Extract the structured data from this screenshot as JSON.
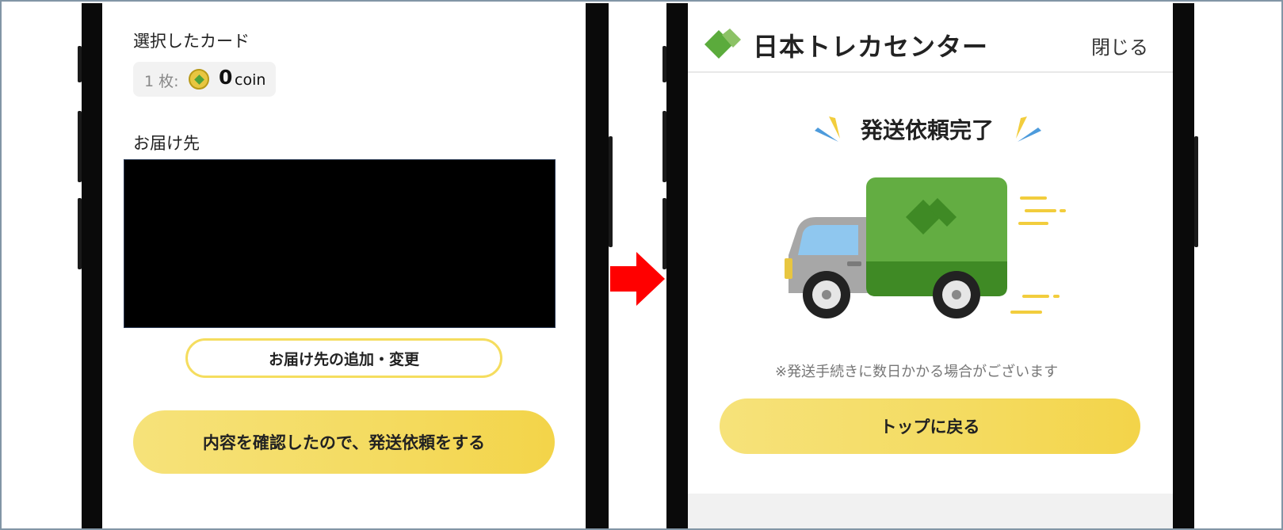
{
  "left_screen": {
    "selected_cards_label": "選択したカード",
    "card_count": "1 枚:",
    "coin_value": "0",
    "coin_unit": "coin",
    "destination_label": "お届け先",
    "change_address_button": "お届け先の追加・変更",
    "confirm_button": "内容を確認したので、発送依頼をする"
  },
  "right_screen": {
    "brand_name": "日本トレカセンター",
    "close_label": "閉じる",
    "completion_title": "発送依頼完了",
    "note": "※発送手続きに数日かかる場合がございます",
    "top_button": "トップに戻る"
  },
  "icons": {
    "coin": "coin-icon",
    "logo": "brand-logo-icon",
    "truck": "delivery-truck-icon",
    "arrow": "right-arrow-icon"
  },
  "colors": {
    "accent_yellow": "#f4db60",
    "brand_green": "#5bab3c",
    "arrow_red": "#ff0000"
  }
}
